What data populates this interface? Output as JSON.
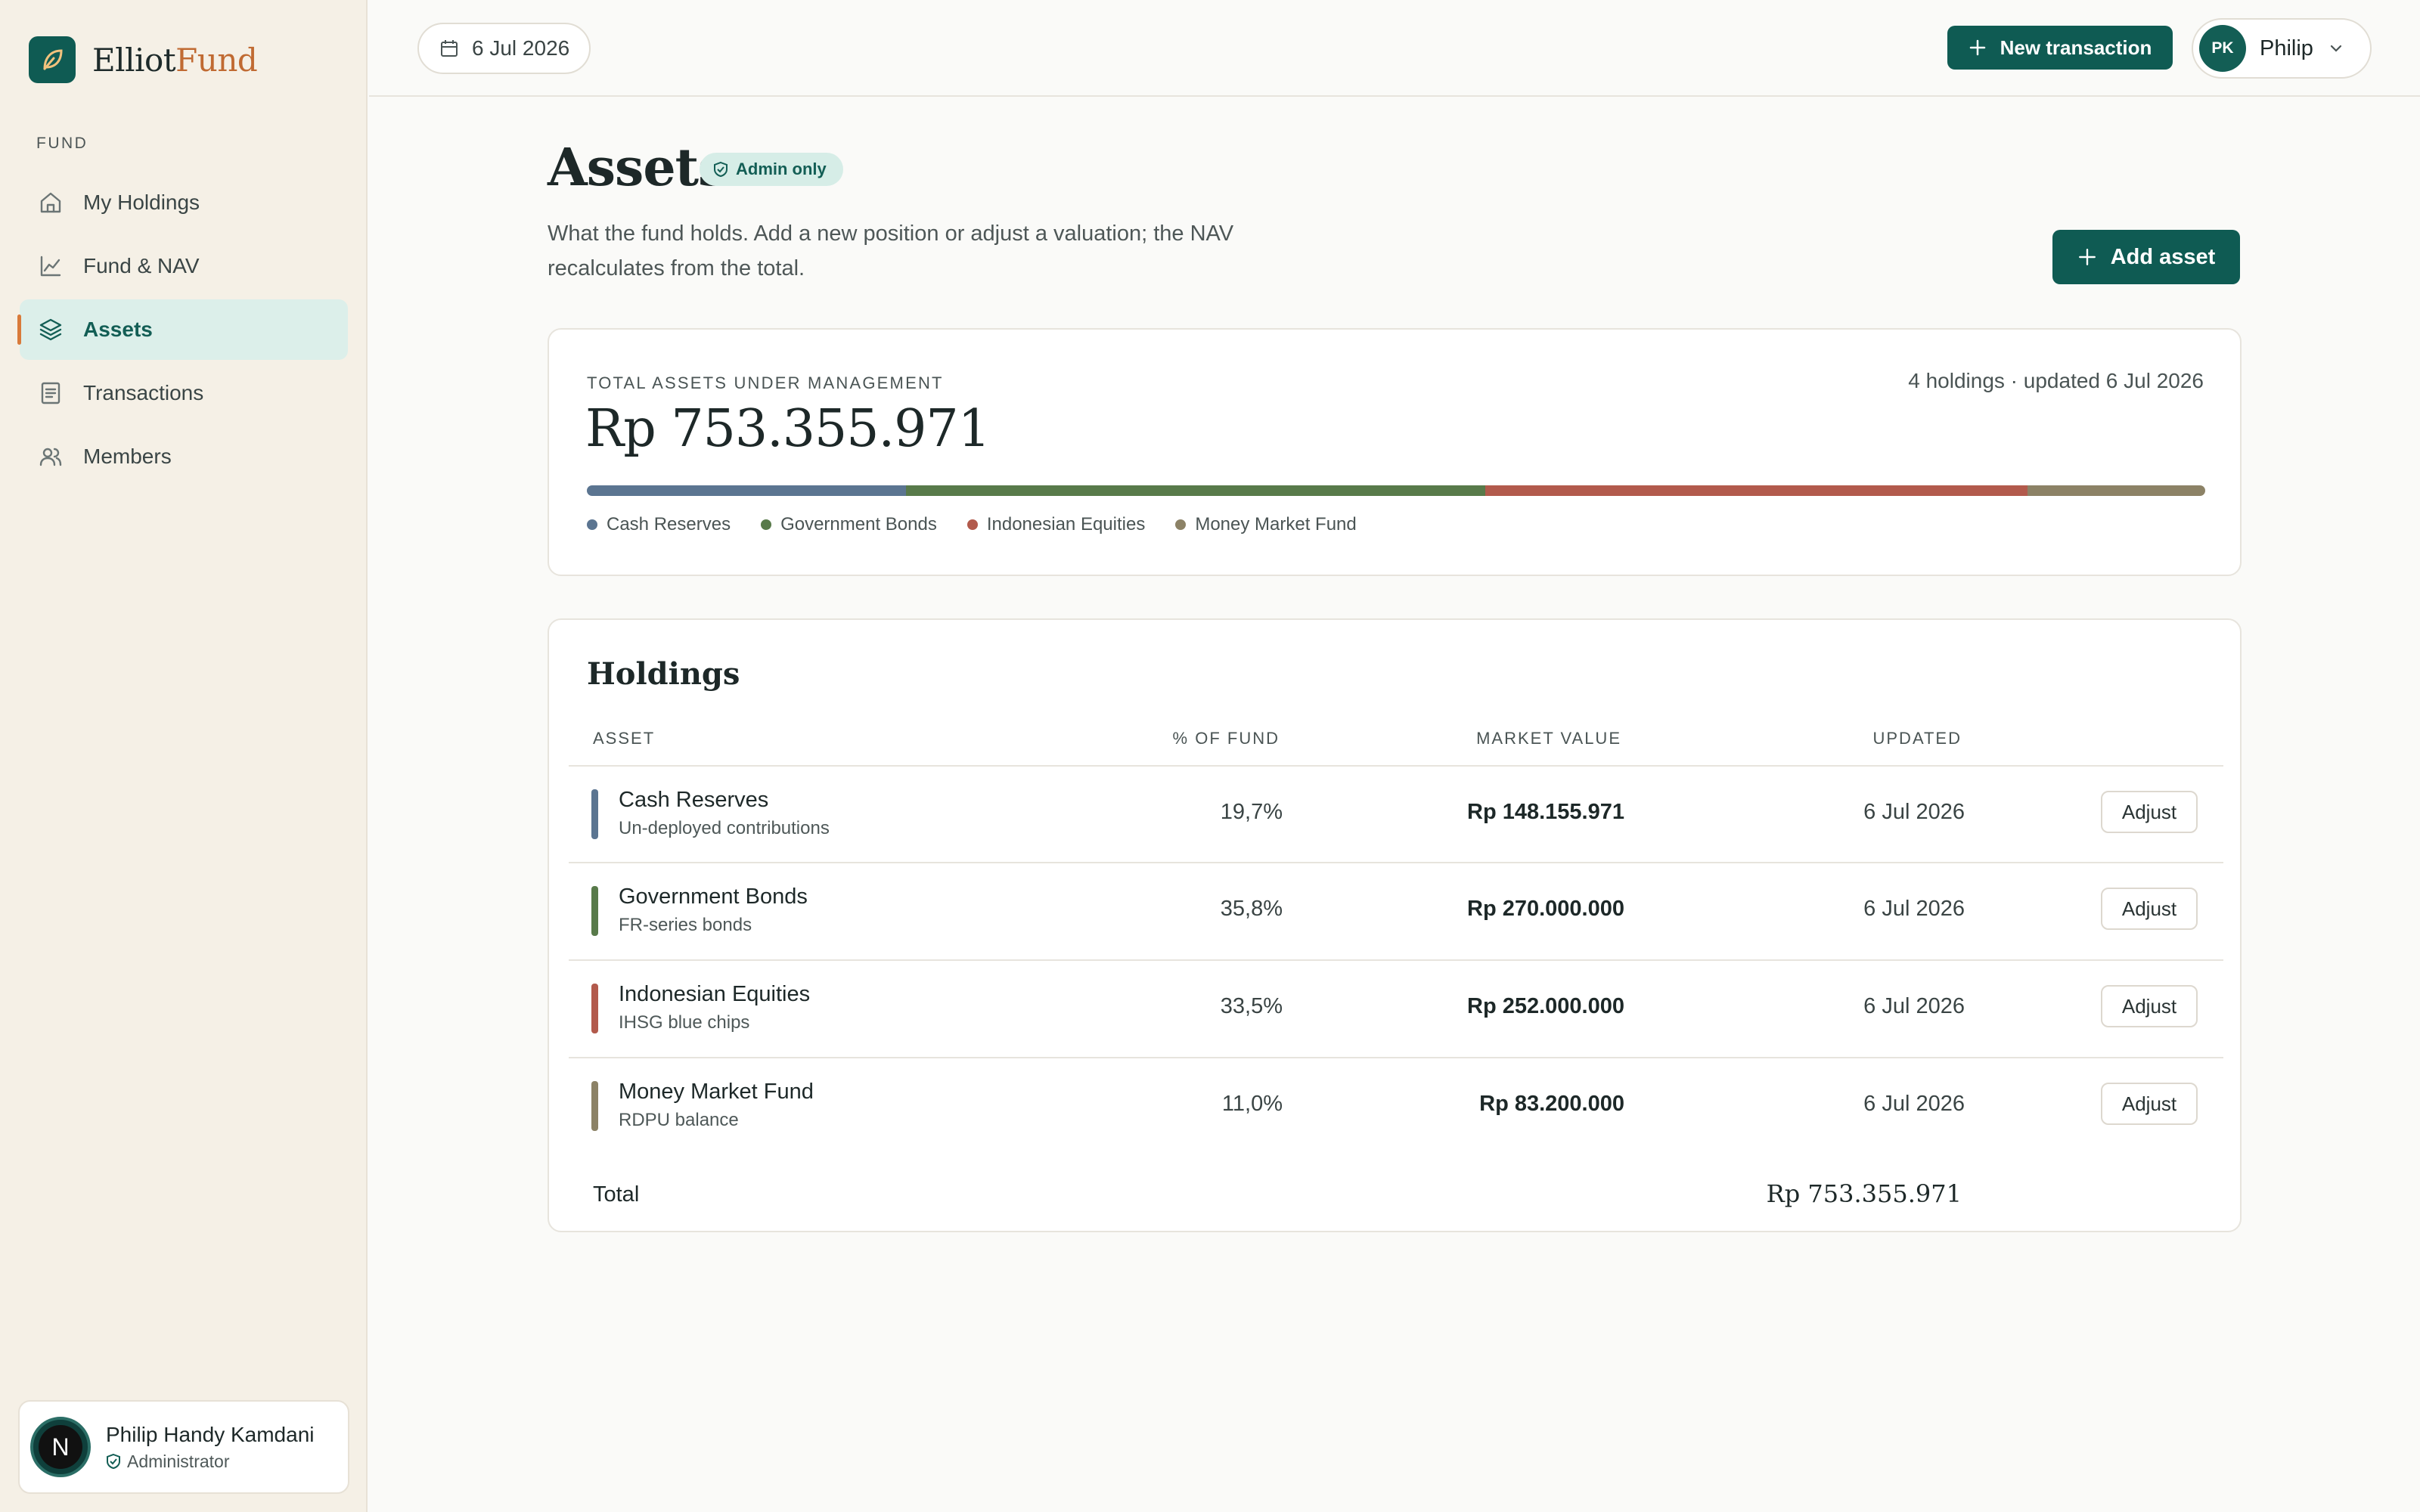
{
  "brand": {
    "name_part1": "Elliot",
    "name_part2": "Fund"
  },
  "sidebar": {
    "section": "FUND",
    "items": [
      {
        "label": "My Holdings",
        "icon": "home-icon"
      },
      {
        "label": "Fund & NAV",
        "icon": "chart-line-icon"
      },
      {
        "label": "Assets",
        "icon": "layers-icon",
        "active": true
      },
      {
        "label": "Transactions",
        "icon": "document-icon"
      },
      {
        "label": "Members",
        "icon": "users-icon"
      }
    ],
    "user": {
      "initial": "N",
      "name": "Philip Handy Kamdani",
      "role": "Administrator"
    }
  },
  "topbar": {
    "date": "6 Jul 2026",
    "new_transaction_label": "New transaction",
    "profile_initials": "PK",
    "profile_name": "Philip"
  },
  "page": {
    "title": "Assets",
    "badge": "Admin only",
    "description": "What the fund holds. Add a new position or adjust a valuation; the NAV recalculates from the total.",
    "add_asset_label": "Add asset"
  },
  "aum": {
    "label": "TOTAL ASSETS UNDER MANAGEMENT",
    "meta": "4 holdings · updated 6 Jul 2026",
    "total": "Rp 753.355.971",
    "allocation": [
      {
        "name": "Cash Reserves",
        "share": 0.197,
        "color": "#5b7591"
      },
      {
        "name": "Government Bonds",
        "share": 0.358,
        "color": "#587a4a"
      },
      {
        "name": "Indonesian Equities",
        "share": 0.335,
        "color": "#b25a4c"
      },
      {
        "name": "Money Market Fund",
        "share": 0.11,
        "color": "#8c8266"
      }
    ]
  },
  "holdings": {
    "title": "Holdings",
    "columns": {
      "asset": "ASSET",
      "pct": "% OF FUND",
      "market_value": "MARKET VALUE",
      "updated": "UPDATED"
    },
    "rows": [
      {
        "name": "Cash Reserves",
        "sub": "Un-deployed contributions",
        "pct": "19,7%",
        "market_value": "Rp 148.155.971",
        "updated": "6 Jul 2026",
        "action": "Adjust",
        "color": "#5b7591"
      },
      {
        "name": "Government Bonds",
        "sub": "FR-series bonds",
        "pct": "35,8%",
        "market_value": "Rp 270.000.000",
        "updated": "6 Jul 2026",
        "action": "Adjust",
        "color": "#587a4a"
      },
      {
        "name": "Indonesian Equities",
        "sub": "IHSG blue chips",
        "pct": "33,5%",
        "market_value": "Rp 252.000.000",
        "updated": "6 Jul 2026",
        "action": "Adjust",
        "color": "#b25a4c"
      },
      {
        "name": "Money Market Fund",
        "sub": "RDPU balance",
        "pct": "11,0%",
        "market_value": "Rp 83.200.000",
        "updated": "6 Jul 2026",
        "action": "Adjust",
        "color": "#8c8266"
      }
    ],
    "total_label": "Total",
    "total_value": "Rp 753.355.971"
  }
}
